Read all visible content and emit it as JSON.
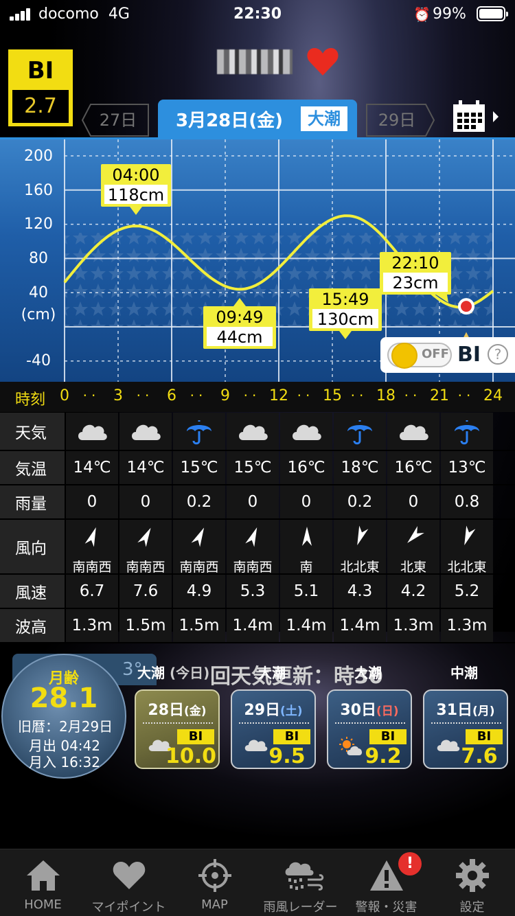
{
  "status_bar": {
    "carrier": "docomo",
    "network": "4G",
    "time": "22:30",
    "alarm_icon": "alarm-icon",
    "battery": "99%"
  },
  "header": {
    "bi_label": "BI",
    "bi_value": "2.7",
    "spot_name_pixelated": true,
    "favorite_icon": "heart-icon",
    "tab_prev": "27日",
    "tab_current_date": "3月28日(金)",
    "tab_current_tide": "大潮",
    "tab_next": "29日",
    "calendar_icon": "calendar-icon"
  },
  "tide_chart": {
    "y_ticks": [
      "200",
      "160",
      "120",
      "80",
      "40",
      "(cm)",
      "-40"
    ],
    "time_label": "時刻",
    "x_ticks": [
      "0",
      "3",
      "6",
      "9",
      "12",
      "15",
      "18",
      "21",
      "24"
    ],
    "extremes": [
      {
        "time": "04:00",
        "height": "118cm"
      },
      {
        "time": "09:49",
        "height": "44cm"
      },
      {
        "time": "15:49",
        "height": "130cm"
      },
      {
        "time": "22:10",
        "height": "23cm"
      }
    ],
    "bi_toggle": {
      "state": "OFF",
      "label": "BI",
      "help": "?"
    },
    "accent": "#f2ee3c"
  },
  "chart_data": {
    "type": "line",
    "x": [
      0,
      4.0,
      9.82,
      15.82,
      22.17,
      24
    ],
    "series": [
      {
        "values": [
          52,
          118,
          44,
          130,
          23,
          42
        ]
      }
    ],
    "ylim": [
      -60,
      210
    ],
    "xlim": [
      0,
      24
    ],
    "ylabel": "(cm)",
    "xlabel": "時刻"
  },
  "weather_table": {
    "labels": {
      "weather": "天気",
      "temp": "気温",
      "rain": "雨量",
      "wind_dir": "風向",
      "wind_speed": "風速",
      "wave": "波高"
    },
    "columns": [
      {
        "weather": "cloud-icon",
        "temp": "14℃",
        "rain": "0",
        "dir": "南南西",
        "speed": "6.7",
        "wave": "1.3m",
        "angle": 20
      },
      {
        "weather": "cloud-icon",
        "temp": "14℃",
        "rain": "0",
        "dir": "南南西",
        "speed": "7.6",
        "wave": "1.5m",
        "angle": 28
      },
      {
        "weather": "umbrella-icon",
        "temp": "15℃",
        "rain": "0.2",
        "dir": "南南西",
        "speed": "4.9",
        "wave": "1.5m",
        "angle": 26
      },
      {
        "weather": "cloud-icon",
        "temp": "15℃",
        "rain": "0",
        "dir": "南南西",
        "speed": "5.3",
        "wave": "1.4m",
        "angle": 22
      },
      {
        "weather": "cloud-icon",
        "temp": "16℃",
        "rain": "0",
        "dir": "南",
        "speed": "5.1",
        "wave": "1.4m",
        "angle": 0
      },
      {
        "weather": "umbrella-icon",
        "temp": "18℃",
        "rain": "0.2",
        "dir": "北北東",
        "speed": "4.3",
        "wave": "1.4m",
        "angle": 200
      },
      {
        "weather": "cloud-icon",
        "temp": "16℃",
        "rain": "0",
        "dir": "北東",
        "speed": "4.2",
        "wave": "1.3m",
        "angle": 225
      },
      {
        "weather": "umbrella-icon",
        "temp": "13℃",
        "rain": "0.8",
        "dir": "北北東",
        "speed": "5.2",
        "wave": "1.3m",
        "angle": 200
      }
    ]
  },
  "moon": {
    "age_label": "月齢",
    "age": "28.1",
    "lunar": "旧暦：2月29日",
    "rise": "月出 04:42",
    "set": "月入 16:32"
  },
  "ticker": {
    "text": "回天気更新：時30",
    "behind_tab": "3°"
  },
  "forecast": [
    {
      "tide": "大潮",
      "note": "(今日)",
      "date": "28日",
      "wd": "(金)",
      "weather": "cloud-icon",
      "bi_label": "BI",
      "bi": "10.0"
    },
    {
      "tide": "大潮",
      "date": "29日",
      "wd": "(土)",
      "weather": "cloud-icon",
      "bi_label": "BI",
      "bi": "9.5"
    },
    {
      "tide": "大潮",
      "date": "30日",
      "wd": "(日)",
      "weather": "sun-cloud-icon",
      "bi_label": "BI",
      "bi": "9.2"
    },
    {
      "tide": "中潮",
      "date": "31日",
      "wd": "(月)",
      "weather": "cloud-icon",
      "bi_label": "BI",
      "bi": "7.6"
    }
  ],
  "tabbar": [
    {
      "label": "HOME",
      "icon": "home-icon"
    },
    {
      "label": "マイポイント",
      "icon": "heart-icon"
    },
    {
      "label": "MAP",
      "icon": "crosshair-icon"
    },
    {
      "label": "雨風レーダー",
      "icon": "rain-wind-icon"
    },
    {
      "label": "警報・災害",
      "icon": "warning-icon",
      "badge": "!"
    },
    {
      "label": "設定",
      "icon": "gear-icon"
    }
  ]
}
